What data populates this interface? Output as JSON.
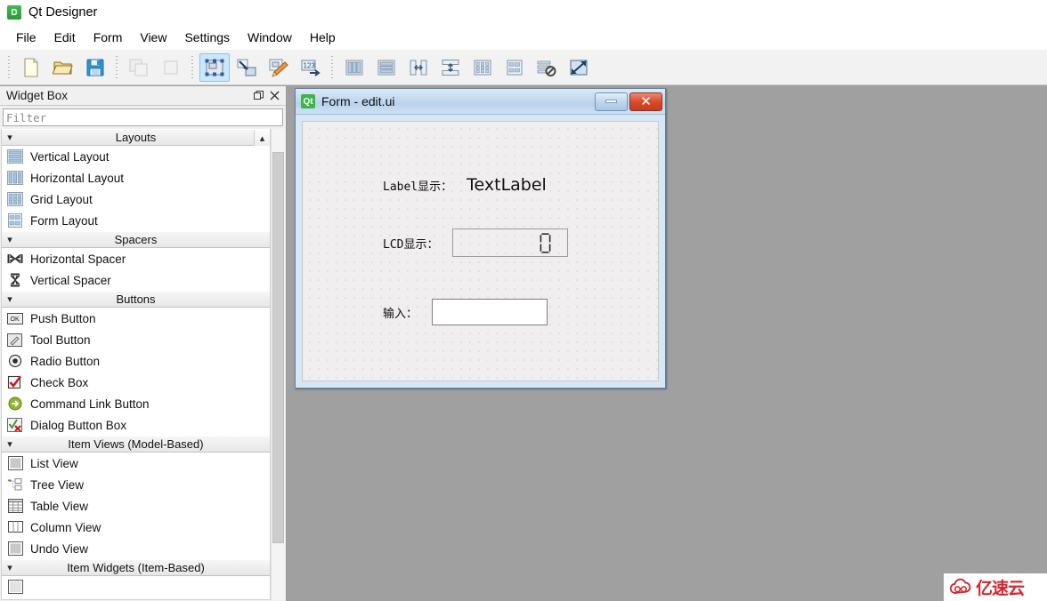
{
  "app": {
    "title": "Qt Designer",
    "icon": "designer-app-icon",
    "icon_text": "D"
  },
  "menubar": {
    "items": [
      {
        "label": "File"
      },
      {
        "label": "Edit"
      },
      {
        "label": "Form"
      },
      {
        "label": "View"
      },
      {
        "label": "Settings"
      },
      {
        "label": "Window"
      },
      {
        "label": "Help"
      }
    ]
  },
  "toolbar": {
    "groups": [
      {
        "buttons": [
          {
            "name": "new-form-button",
            "icon": "new-document-icon",
            "state": "enabled"
          },
          {
            "name": "open-form-button",
            "icon": "open-folder-icon",
            "state": "enabled"
          },
          {
            "name": "save-form-button",
            "icon": "save-disk-icon",
            "state": "enabled"
          }
        ]
      },
      {
        "buttons": [
          {
            "name": "undo-button",
            "icon": "copy-pages-icon",
            "state": "disabled"
          },
          {
            "name": "redo-button",
            "icon": "single-page-icon",
            "state": "disabled"
          }
        ]
      },
      {
        "buttons": [
          {
            "name": "edit-widgets-button",
            "icon": "edit-widgets-icon",
            "state": "active"
          },
          {
            "name": "edit-signals-slots-button",
            "icon": "signals-slots-icon",
            "state": "enabled"
          },
          {
            "name": "edit-buddies-button",
            "icon": "edit-buddies-icon",
            "state": "enabled"
          },
          {
            "name": "edit-tab-order-button",
            "icon": "tab-order-icon",
            "state": "enabled"
          }
        ]
      },
      {
        "buttons": [
          {
            "name": "layout-horizontally-button",
            "icon": "layout-horizontal-icon",
            "state": "enabled"
          },
          {
            "name": "layout-vertically-button",
            "icon": "layout-vertical-icon",
            "state": "enabled"
          },
          {
            "name": "layout-splitter-horizontal-button",
            "icon": "splitter-horizontal-icon",
            "state": "enabled"
          },
          {
            "name": "layout-splitter-vertical-button",
            "icon": "splitter-vertical-icon",
            "state": "enabled"
          },
          {
            "name": "layout-grid-button",
            "icon": "layout-grid-icon",
            "state": "enabled"
          },
          {
            "name": "layout-form-button",
            "icon": "layout-form-icon",
            "state": "enabled"
          },
          {
            "name": "break-layout-button",
            "icon": "break-layout-icon",
            "state": "enabled"
          },
          {
            "name": "adjust-size-button",
            "icon": "adjust-size-icon",
            "state": "enabled"
          }
        ]
      }
    ]
  },
  "widget_box": {
    "title": "Widget Box",
    "float_button_icon": "float-dock-icon",
    "close_button_icon": "close-icon",
    "filter": {
      "value": "",
      "placeholder": "Filter"
    },
    "sections": [
      {
        "label": "Layouts",
        "expanded": true,
        "collapse_icon": "chevron-down-icon",
        "scroll_up_icon": "chevron-up-icon",
        "items": [
          {
            "label": "Vertical Layout",
            "icon": "vertical-layout-icon"
          },
          {
            "label": "Horizontal Layout",
            "icon": "horizontal-layout-icon"
          },
          {
            "label": "Grid Layout",
            "icon": "grid-layout-icon"
          },
          {
            "label": "Form Layout",
            "icon": "form-layout-icon"
          }
        ]
      },
      {
        "label": "Spacers",
        "expanded": true,
        "collapse_icon": "chevron-down-icon",
        "items": [
          {
            "label": "Horizontal Spacer",
            "icon": "horizontal-spacer-icon"
          },
          {
            "label": "Vertical Spacer",
            "icon": "vertical-spacer-icon"
          }
        ]
      },
      {
        "label": "Buttons",
        "expanded": true,
        "collapse_icon": "chevron-down-icon",
        "items": [
          {
            "label": "Push Button",
            "icon": "push-button-icon"
          },
          {
            "label": "Tool Button",
            "icon": "tool-button-icon"
          },
          {
            "label": "Radio Button",
            "icon": "radio-button-icon"
          },
          {
            "label": "Check Box",
            "icon": "check-box-icon"
          },
          {
            "label": "Command Link Button",
            "icon": "command-link-button-icon"
          },
          {
            "label": "Dialog Button Box",
            "icon": "dialog-button-box-icon"
          }
        ]
      },
      {
        "label": "Item Views (Model-Based)",
        "expanded": true,
        "collapse_icon": "chevron-down-icon",
        "items": [
          {
            "label": "List View",
            "icon": "list-view-icon"
          },
          {
            "label": "Tree View",
            "icon": "tree-view-icon"
          },
          {
            "label": "Table View",
            "icon": "table-view-icon"
          },
          {
            "label": "Column View",
            "icon": "column-view-icon"
          },
          {
            "label": "Undo View",
            "icon": "undo-view-icon"
          }
        ]
      },
      {
        "label": "Item Widgets (Item-Based)",
        "expanded": true,
        "collapse_icon": "chevron-down-icon",
        "items": []
      }
    ]
  },
  "form_window": {
    "icon": "qt-logo-icon",
    "icon_text": "Qt",
    "title": "Form - edit.ui",
    "minimize_button_icon": "minimize-icon",
    "close_button_icon": "close-icon",
    "close_button_glyph": "✕",
    "widgets": [
      {
        "name": "label-display-caption",
        "type": "label",
        "text": "Label显示："
      },
      {
        "name": "text-label",
        "type": "label",
        "text": "TextLabel"
      },
      {
        "name": "lcd-display-caption",
        "type": "label",
        "text": "LCD显示："
      },
      {
        "name": "lcd-number",
        "type": "lcdnumber",
        "value": "0"
      },
      {
        "name": "input-caption",
        "type": "label",
        "text": "输入："
      },
      {
        "name": "line-edit",
        "type": "lineedit",
        "value": "",
        "placeholder": ""
      }
    ]
  },
  "watermark": {
    "logo_icon": "cloud-logo-icon",
    "text": "亿速云"
  },
  "colors": {
    "accent": "#3cb54a",
    "close_red": "#d94b2c",
    "toolbar_active": "#cce7fa",
    "mdi_background": "#a0a0a0",
    "form_canvas": "#f0eeee",
    "watermark_red": "#d4242c"
  }
}
